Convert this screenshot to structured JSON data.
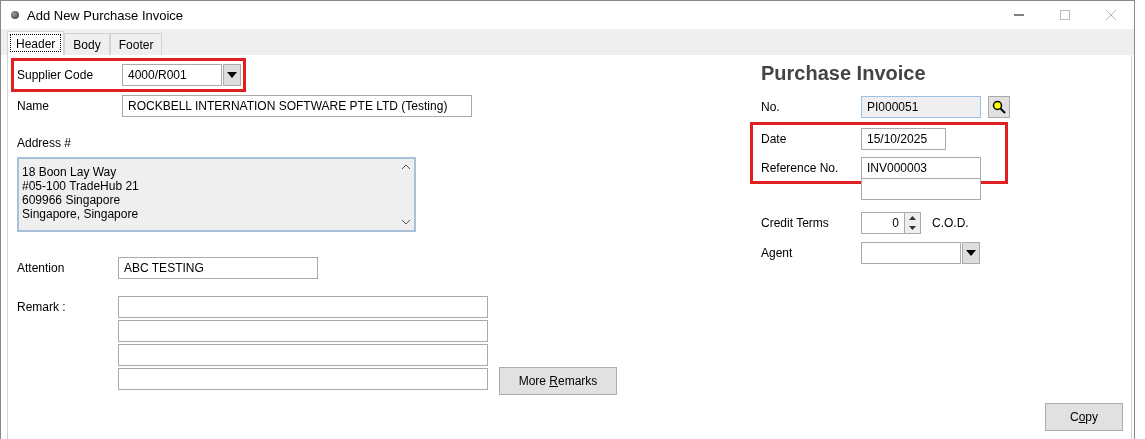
{
  "window": {
    "title": "Add New Purchase Invoice"
  },
  "tabs": [
    {
      "label": "Header",
      "selected": true
    },
    {
      "label": "Body",
      "selected": false
    },
    {
      "label": "Footer",
      "selected": false
    }
  ],
  "supplier_code": {
    "label": "Supplier Code",
    "value": "4000/R001",
    "highlighted": true
  },
  "name": {
    "label": "Name",
    "value": "ROCKBELL INTERNATION SOFTWARE PTE LTD (Testing)"
  },
  "address": {
    "label": "Address #",
    "lines": [
      "18 Boon Lay Way",
      "#05-100 TradeHub 21",
      "609966 Singapore",
      "Singapore, Singapore"
    ]
  },
  "attention": {
    "label": "Attention",
    "value": "ABC TESTING"
  },
  "remark": {
    "label": "Remark :"
  },
  "more_remarks_button": {
    "before": "More ",
    "key": "R",
    "after": "emarks"
  },
  "invoice": {
    "title": "Purchase Invoice",
    "number": {
      "label": "No.",
      "value": "PI000051"
    },
    "marked_group": {
      "highlighted": true,
      "rows": [
        {
          "label": "Date",
          "value": "15/10/2025",
          "kind": "short"
        },
        {
          "label": "Reference No.",
          "value": "INV000003",
          "kind": "long"
        }
      ]
    },
    "credit_terms": {
      "label": "Credit Terms",
      "value": "0",
      "unit": "C.O.D."
    },
    "agent": {
      "label": "Agent"
    }
  },
  "copy_button": {
    "before": "C",
    "key": "o",
    "after": "py"
  }
}
